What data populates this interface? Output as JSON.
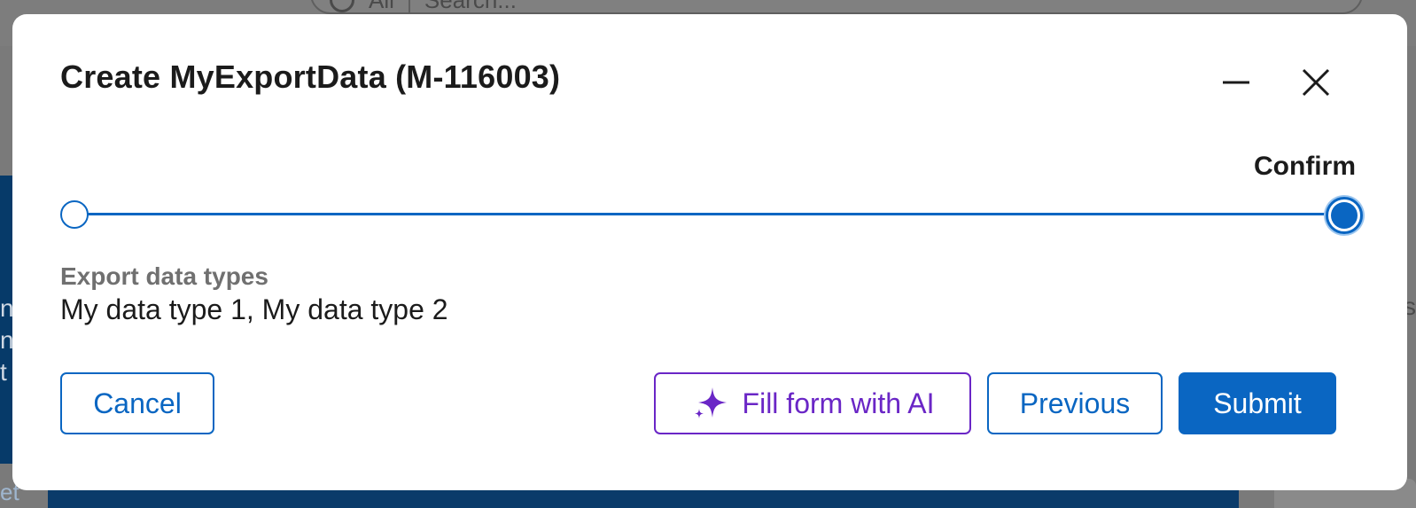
{
  "background": {
    "search": {
      "scope": "All",
      "placeholder": "Search..."
    },
    "left_fragments": [
      "n",
      "n",
      "t"
    ],
    "bottom_left_fragment": "et",
    "right_fragment": "s"
  },
  "modal": {
    "title": "Create MyExportData (M-116003)",
    "minimize_icon": "minimize-icon",
    "close_icon": "close-icon"
  },
  "stepper": {
    "current_step_label": "Confirm",
    "progress": 1.0
  },
  "field": {
    "label": "Export data types",
    "value": "My data type 1, My data type 2"
  },
  "buttons": {
    "cancel": "Cancel",
    "fill_ai": "Fill form with AI",
    "fill_ai_icon": "sparkle-icon",
    "previous": "Previous",
    "submit": "Submit"
  },
  "colors": {
    "primary": "#0a66c2",
    "ai_accent": "#6a26c6",
    "overlay": "#7a7a7a"
  }
}
